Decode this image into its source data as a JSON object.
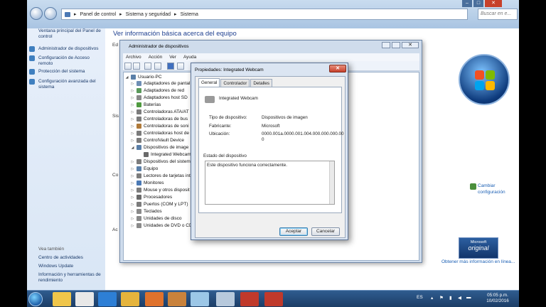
{
  "addressbar": {
    "crumbs": [
      "Panel de control",
      "Sistema y seguridad",
      "Sistema"
    ],
    "search_placeholder": "Buscar en e..."
  },
  "sidebar": {
    "items": [
      {
        "label": "Ventana principal del Panel de control"
      },
      {
        "label": "Administrador de dispositivos"
      },
      {
        "label": "Configuración de Acceso remoto"
      },
      {
        "label": "Protección del sistema"
      },
      {
        "label": "Configuración avanzada del sistema"
      }
    ],
    "see_also_heading": "Vea también",
    "see_also": [
      {
        "label": "Centro de actividades"
      },
      {
        "label": "Windows Update"
      },
      {
        "label": "Información y herramientas de rendimiento"
      }
    ]
  },
  "main": {
    "title": "Ver información básica acerca del equipo",
    "clipped_left": [
      "Ed",
      "Sis",
      "Co",
      "Ac"
    ],
    "change_config": "Cambiar configuración",
    "genuine_label": "original",
    "genuine_sub": "Microsoft",
    "genuine_link": "Obtener más información en línea..."
  },
  "device_manager": {
    "title": "Administrador de dispositivos",
    "menu": [
      "Archivo",
      "Acción",
      "Ver",
      "Ayuda"
    ],
    "root": "Usuario-PC",
    "nodes": [
      "Adaptadores de pantal",
      "Adaptadores de red",
      "Adaptadores host SD",
      "Baterías",
      "Controladoras ATA/AT",
      "Controladoras de bus",
      "Controladoras de soni",
      "Controladoras host de",
      "ControlVault Device",
      "Dispositivos de image",
      "Integrated Webcam",
      "Dispositivos del sistem",
      "Equipo",
      "Lectores de tarjetas int",
      "Monitores",
      "Mouse y otros disposit",
      "Procesadores",
      "Puertos (COM y LPT)",
      "Teclados",
      "Unidades de disco",
      "Unidades de DVD o CD"
    ]
  },
  "properties": {
    "title": "Propiedades: Integrated Webcam",
    "tabs": [
      "General",
      "Controlador",
      "Detalles"
    ],
    "device_name": "Integrated Webcam",
    "type_label": "Tipo de dispositivo:",
    "type_value": "Dispositivos de imagen",
    "maker_label": "Fabricante:",
    "maker_value": "Microsoft",
    "location_label": "Ubicación:",
    "location_value": "0000.001a.0000.001.004.000.000.000.00 0",
    "status_group": "Estado del dispositivo",
    "status_text": "Este dispositivo funciona correctamente.",
    "ok": "Aceptar",
    "cancel": "Cancelar"
  },
  "taskbar": {
    "lang": "ES",
    "time": "05:05 p.m.",
    "date": "10/02/2016"
  }
}
